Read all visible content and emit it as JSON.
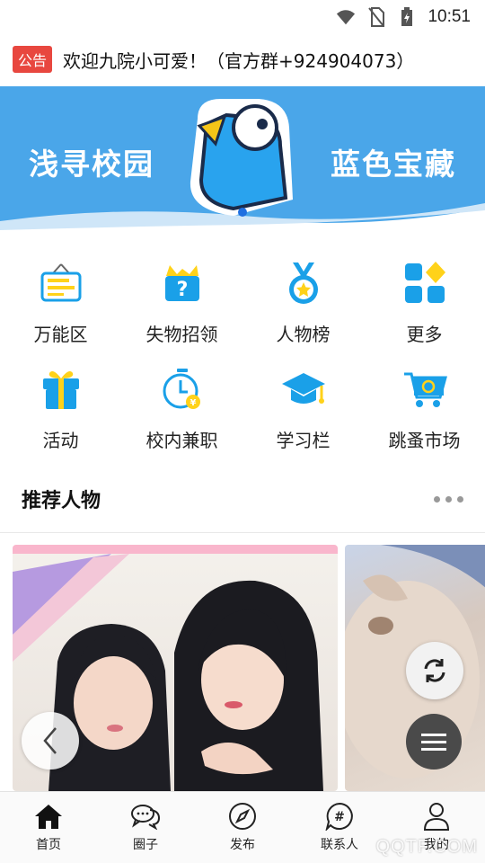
{
  "status_bar": {
    "time": "10:51",
    "icons": [
      "wifi-icon",
      "no-sim-icon",
      "battery-charging-icon"
    ]
  },
  "notice": {
    "tag": "公告",
    "text": "欢迎九院小可爱！（官方群+924904073）"
  },
  "banner": {
    "left_slogan": "浅寻校园",
    "right_slogan": "蓝色宝藏",
    "brand_color": "#4aa6e9"
  },
  "grid": {
    "rows": [
      [
        {
          "label": "万能区",
          "icon": "board-icon"
        },
        {
          "label": "失物招领",
          "icon": "question-box-icon"
        },
        {
          "label": "人物榜",
          "icon": "medal-icon"
        },
        {
          "label": "更多",
          "icon": "more-grid-icon"
        }
      ],
      [
        {
          "label": "活动",
          "icon": "gift-icon"
        },
        {
          "label": "校内兼职",
          "icon": "clock-coin-icon"
        },
        {
          "label": "学习栏",
          "icon": "graduation-cap-icon"
        },
        {
          "label": "跳蚤市场",
          "icon": "recycle-cart-icon"
        }
      ]
    ]
  },
  "section": {
    "title": "推荐人物"
  },
  "cards": [
    {
      "icon": "photo-two-girls"
    },
    {
      "icon": "photo-pet"
    }
  ],
  "tabbar": [
    {
      "label": "首页",
      "icon": "home-icon",
      "active": true
    },
    {
      "label": "圈子",
      "icon": "chat-bubbles-icon"
    },
    {
      "label": "发布",
      "icon": "compass-icon"
    },
    {
      "label": "联系人",
      "icon": "hashtag-bubble-icon"
    },
    {
      "label": "我的",
      "icon": "person-icon"
    }
  ],
  "watermark": "QQTF.COM",
  "colors": {
    "accent": "#4aa6e9",
    "tag_red": "#e8473f",
    "icon_blue": "#1aa0e8",
    "icon_yellow": "#ffd21a"
  }
}
